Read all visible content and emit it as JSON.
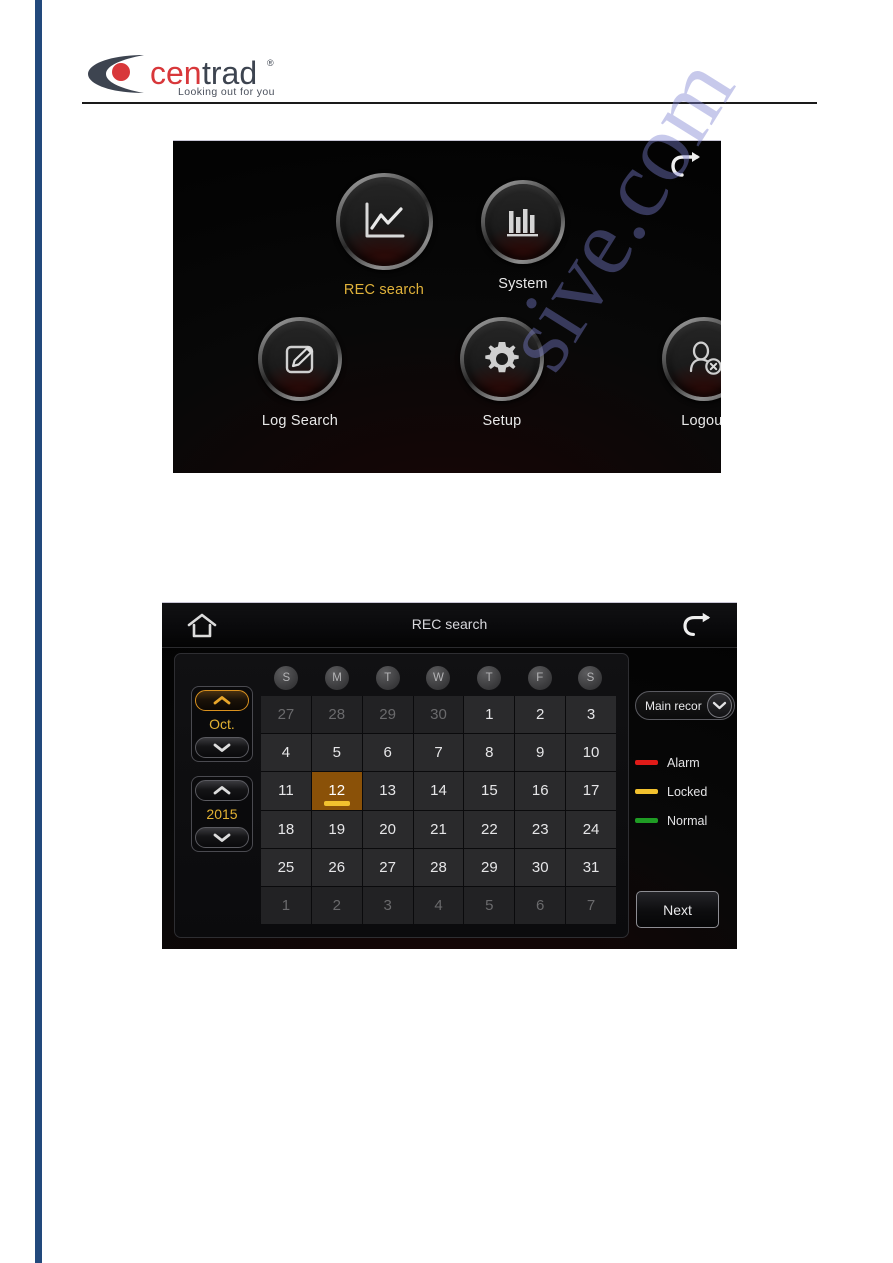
{
  "brand": {
    "name_part1": "cen",
    "name_part2": "trad",
    "registered": "®",
    "tagline": "Looking out for you"
  },
  "watermark": {
    "text": "sive.com"
  },
  "main_menu": {
    "back_icon": "back-arrow-icon",
    "items": [
      {
        "label": "REC search",
        "icon": "line-chart-icon",
        "active": true
      },
      {
        "label": "System",
        "icon": "bar-chart-icon",
        "active": false
      },
      {
        "label": "Log Search",
        "icon": "pencil-square-icon",
        "active": false
      },
      {
        "label": "Setup",
        "icon": "gear-icon",
        "active": false
      },
      {
        "label": "Logout",
        "icon": "user-logout-icon",
        "active": false
      }
    ]
  },
  "rec_search": {
    "title": "REC search",
    "home_icon": "home-icon",
    "back_icon": "back-arrow-icon",
    "month": {
      "value": "Oct.",
      "up_focused": true
    },
    "year": {
      "value": "2015",
      "up_focused": false
    },
    "weekdays": [
      "S",
      "M",
      "T",
      "W",
      "T",
      "F",
      "S"
    ],
    "days": [
      {
        "n": "27",
        "muted": true,
        "selected": false,
        "mark": ""
      },
      {
        "n": "28",
        "muted": true,
        "selected": false,
        "mark": ""
      },
      {
        "n": "29",
        "muted": true,
        "selected": false,
        "mark": ""
      },
      {
        "n": "30",
        "muted": true,
        "selected": false,
        "mark": ""
      },
      {
        "n": "1",
        "muted": false,
        "selected": false,
        "mark": ""
      },
      {
        "n": "2",
        "muted": false,
        "selected": false,
        "mark": ""
      },
      {
        "n": "3",
        "muted": false,
        "selected": false,
        "mark": ""
      },
      {
        "n": "4",
        "muted": false,
        "selected": false,
        "mark": ""
      },
      {
        "n": "5",
        "muted": false,
        "selected": false,
        "mark": ""
      },
      {
        "n": "6",
        "muted": false,
        "selected": false,
        "mark": ""
      },
      {
        "n": "7",
        "muted": false,
        "selected": false,
        "mark": ""
      },
      {
        "n": "8",
        "muted": false,
        "selected": false,
        "mark": ""
      },
      {
        "n": "9",
        "muted": false,
        "selected": false,
        "mark": ""
      },
      {
        "n": "10",
        "muted": false,
        "selected": false,
        "mark": ""
      },
      {
        "n": "11",
        "muted": false,
        "selected": false,
        "mark": ""
      },
      {
        "n": "12",
        "muted": false,
        "selected": true,
        "mark": "#f2c12e"
      },
      {
        "n": "13",
        "muted": false,
        "selected": false,
        "mark": ""
      },
      {
        "n": "14",
        "muted": false,
        "selected": false,
        "mark": ""
      },
      {
        "n": "15",
        "muted": false,
        "selected": false,
        "mark": ""
      },
      {
        "n": "16",
        "muted": false,
        "selected": false,
        "mark": ""
      },
      {
        "n": "17",
        "muted": false,
        "selected": false,
        "mark": ""
      },
      {
        "n": "18",
        "muted": false,
        "selected": false,
        "mark": ""
      },
      {
        "n": "19",
        "muted": false,
        "selected": false,
        "mark": ""
      },
      {
        "n": "20",
        "muted": false,
        "selected": false,
        "mark": ""
      },
      {
        "n": "21",
        "muted": false,
        "selected": false,
        "mark": ""
      },
      {
        "n": "22",
        "muted": false,
        "selected": false,
        "mark": ""
      },
      {
        "n": "23",
        "muted": false,
        "selected": false,
        "mark": ""
      },
      {
        "n": "24",
        "muted": false,
        "selected": false,
        "mark": ""
      },
      {
        "n": "25",
        "muted": false,
        "selected": false,
        "mark": ""
      },
      {
        "n": "26",
        "muted": false,
        "selected": false,
        "mark": ""
      },
      {
        "n": "27",
        "muted": false,
        "selected": false,
        "mark": ""
      },
      {
        "n": "28",
        "muted": false,
        "selected": false,
        "mark": ""
      },
      {
        "n": "29",
        "muted": false,
        "selected": false,
        "mark": ""
      },
      {
        "n": "30",
        "muted": false,
        "selected": false,
        "mark": ""
      },
      {
        "n": "31",
        "muted": false,
        "selected": false,
        "mark": ""
      },
      {
        "n": "1",
        "muted": true,
        "selected": false,
        "mark": ""
      },
      {
        "n": "2",
        "muted": true,
        "selected": false,
        "mark": ""
      },
      {
        "n": "3",
        "muted": true,
        "selected": false,
        "mark": ""
      },
      {
        "n": "4",
        "muted": true,
        "selected": false,
        "mark": ""
      },
      {
        "n": "5",
        "muted": true,
        "selected": false,
        "mark": ""
      },
      {
        "n": "6",
        "muted": true,
        "selected": false,
        "mark": ""
      },
      {
        "n": "7",
        "muted": true,
        "selected": false,
        "mark": ""
      }
    ],
    "record_type": {
      "selected": "Main recor",
      "icon": "chevron-down-icon"
    },
    "legend": [
      {
        "label": "Alarm",
        "color": "#e01b18"
      },
      {
        "label": "Locked",
        "color": "#f2c12e"
      },
      {
        "label": "Normal",
        "color": "#1f9c24"
      }
    ],
    "next_label": "Next"
  },
  "colors": {
    "margin_rule": "#22497c",
    "brand_red": "#d8373a",
    "brand_dark": "#3d4450",
    "accent_amber": "#e3b233",
    "selected_day_bg": "#8a5108"
  }
}
